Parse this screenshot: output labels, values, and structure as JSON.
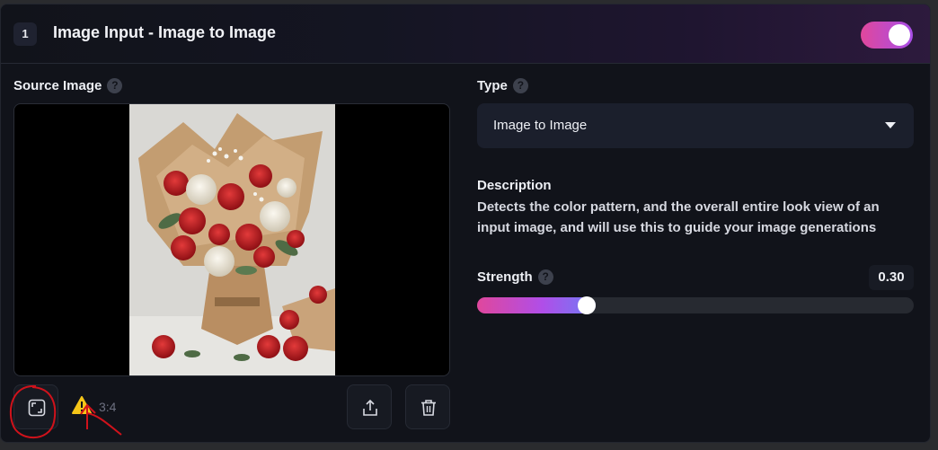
{
  "header": {
    "step_number": "1",
    "title": "Image Input - Image to Image",
    "enabled": true
  },
  "source_image": {
    "label": "Source Image",
    "help": "?",
    "image_description": "Bouquet of red and white roses wrapped in kraft paper",
    "aspect_ratio": "3:4"
  },
  "type_field": {
    "label": "Type",
    "help": "?",
    "value": "Image to Image"
  },
  "description": {
    "label": "Description",
    "text": "Detects the color pattern, and the overall entire look view of an input image, and will use this to guide your image generations"
  },
  "strength": {
    "label": "Strength",
    "help": "?",
    "value": "0.30",
    "level": 0.25
  },
  "icons": {
    "crop": "aspect-ratio-icon",
    "warning": "warning-icon",
    "upload": "upload-icon",
    "delete": "trash-icon"
  },
  "colors": {
    "accent_pink": "#e0479c",
    "accent_purple": "#a84ee8",
    "warning": "#f5c518",
    "annotation": "#d0121b"
  }
}
